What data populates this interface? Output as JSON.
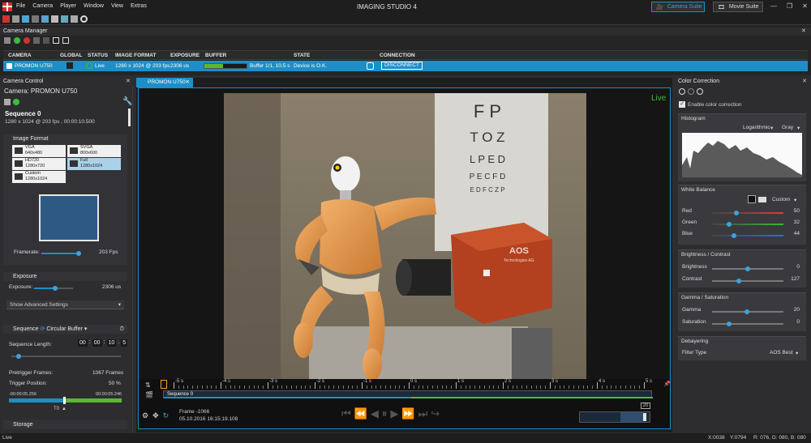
{
  "app": {
    "title": "IMAGING STUDIO 4",
    "menu": [
      "File",
      "Camera",
      "Player",
      "Window",
      "View",
      "Extras"
    ],
    "suites": [
      "Camera Suite",
      "Movie Suite"
    ],
    "window_controls": [
      "—",
      "❐",
      "✕"
    ]
  },
  "camera_manager": {
    "title": "Camera Manager",
    "columns": [
      "CAMERA",
      "GLOBAL",
      "STATUS",
      "IMAGE FORMAT",
      "EXPOSURE",
      "BUFFER",
      "STATE",
      "CONNECTION"
    ],
    "row": {
      "camera": "PROMON U750",
      "status": "Live",
      "image_format": "1280 x 1024 @ 203 fps",
      "exposure": "2306 us",
      "buffer": "Buffer 1/1, 10.5 s",
      "buffer_fill": 0.45,
      "state": "Device is O.K.",
      "connection": "DISCONNECT"
    }
  },
  "camera_control": {
    "title": "Camera Control",
    "camera_label": "Camera:",
    "camera_name": "PROMON U750",
    "sequence_title": "Sequence 0",
    "sequence_info": "1280 x 1024 @ 203 fps , 00:00:10.500",
    "image_format_title": "Image Format",
    "formats": [
      {
        "name": "VGA",
        "res": "640x480",
        "selected": false
      },
      {
        "name": "SVGA",
        "res": "800x600",
        "selected": false
      },
      {
        "name": "HD720",
        "res": "1280x720",
        "selected": false
      },
      {
        "name": "Full",
        "res": "1280x1024",
        "selected": true
      },
      {
        "name": "Custom",
        "res": "1280x1024",
        "selected": false
      }
    ],
    "framerate_label": "Framerate:",
    "framerate_value": "203 Fps",
    "framerate_level": 0.95,
    "exposure_title": "Exposure",
    "exposure_label": "Exposure:",
    "exposure_value": "2306 us",
    "exposure_level": 0.55,
    "advanced_settings": "Show Advanced Settings",
    "sequence_section": "Sequence",
    "buffer_mode": "Circular Buffer",
    "sequence_length_label": "Sequence Length:",
    "sequence_length": [
      "00",
      "00",
      "10",
      "5"
    ],
    "pretrigger_label": "Pretrigger Frames:",
    "pretrigger_value": "1067 Frames",
    "trigger_position_label": "Trigger Position:",
    "trigger_position_value": "50 %",
    "time_start": "-00:00:05.256",
    "time_end": "00:00:05.246",
    "trigger_marker": "T0",
    "storage_title": "Storage"
  },
  "viewer": {
    "tab": "PROMON U750",
    "live_badge": "Live",
    "timeline_ticks": [
      "-5 s",
      "-4 s",
      "-3 s",
      "-2 s",
      "-1 s",
      "0 s",
      "1 s",
      "2 s",
      "3 s",
      "4 s",
      "5 s"
    ],
    "sequence_label": "Sequence 0",
    "frame": "Frame -1066",
    "timestamp": "05.10.2016 16:15:19.108",
    "speed_value": "20",
    "chart_labels": [
      "F P",
      "T O Z",
      "L P E D",
      "P E C F D",
      "E D F C Z P"
    ],
    "camera_brand": "AOS",
    "camera_sub": "Technologies AG"
  },
  "color_correction": {
    "title": "Color Correction",
    "enable_label": "Enable color correction",
    "histogram_title": "Histogram",
    "histogram_scale": "Logarithmic",
    "histogram_channel": "Gray",
    "white_balance_title": "White Balance",
    "white_balance_mode": "Custom",
    "red_label": "Red",
    "red_value": "50",
    "green_label": "Green",
    "green_value": "32",
    "blue_label": "Blue",
    "blue_value": "44",
    "bc_title": "Brightness / Contrast",
    "brightness_label": "Brightness",
    "brightness_value": "0",
    "contrast_label": "Contrast",
    "contrast_value": "127",
    "gs_title": "Gamma / Saturation",
    "gamma_label": "Gamma",
    "gamma_value": "20",
    "saturation_label": "Saturation",
    "saturation_value": "0",
    "debayer_title": "Debayering",
    "filter_label": "Filter Type",
    "filter_value": "AOS Best"
  },
  "status_bar": {
    "left": "Live",
    "x": "X:0038",
    "y": "Y:0794",
    "rgb": "R: 076, G: 080, B: 080"
  },
  "colors": {
    "accent": "#1c8fc6",
    "live_green": "#3dbb3d",
    "buffer_green": "#5db82c"
  }
}
